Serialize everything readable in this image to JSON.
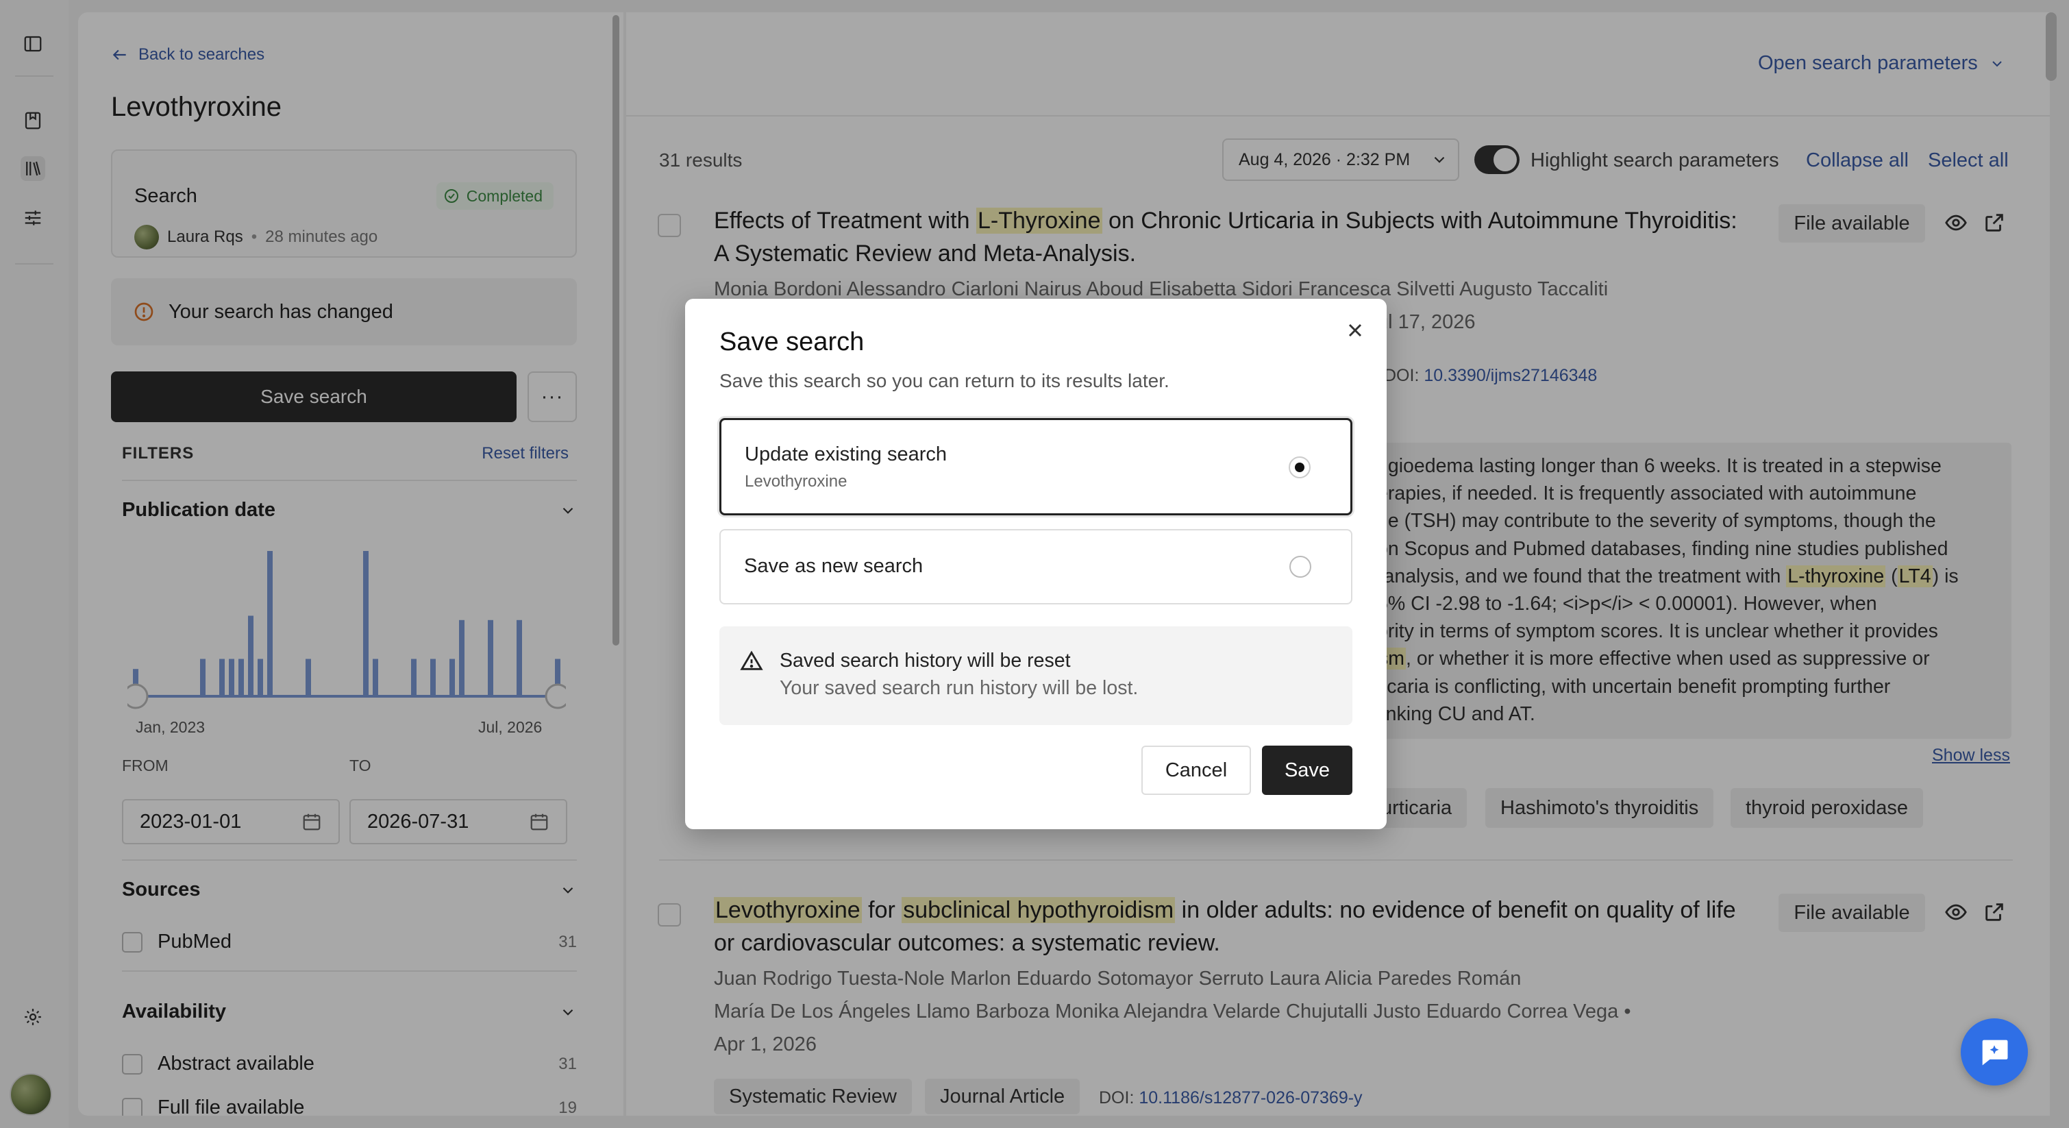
{
  "sidebar_left": {
    "panel_toggle_icon": "sidebar-toggle-icon",
    "nav_icons": [
      "bookmark-icon",
      "library-icon",
      "sliders-icon"
    ],
    "settings_icon": "gear-icon"
  },
  "search_panel": {
    "back_label": "Back to searches",
    "title": "Levothyroxine",
    "card": {
      "title": "Search",
      "status": "Completed",
      "user": "Laura Rqs",
      "time": "28 minutes ago"
    },
    "changed_notice": "Your search has changed",
    "save_label": "Save search",
    "more_label": "···",
    "filters_label": "FILTERS",
    "reset_label": "Reset filters",
    "publication_date": {
      "heading": "Publication date",
      "histogram_levels": [
        0.18,
        0,
        0,
        0,
        0,
        0,
        0,
        0.25,
        0,
        0.25,
        0.25,
        0.25,
        0.55,
        0.25,
        1.0,
        0,
        0,
        0,
        0.25,
        0,
        0,
        0,
        0,
        0,
        1.0,
        0.25,
        0,
        0,
        0,
        0.25,
        0,
        0.25,
        0,
        0.25,
        0.52,
        0,
        0,
        0.52,
        0,
        0,
        0.52,
        0,
        0,
        0,
        0.25
      ],
      "start_label": "Jan, 2023",
      "end_label": "Jul, 2026",
      "from_label": "FROM",
      "to_label": "TO",
      "from_value": "2023-01-01",
      "to_value": "2026-07-31"
    },
    "sources": {
      "heading": "Sources",
      "items": [
        {
          "label": "PubMed",
          "count": "31"
        }
      ]
    },
    "availability": {
      "heading": "Availability",
      "items": [
        {
          "label": "Abstract available",
          "count": "31"
        },
        {
          "label": "Full file available",
          "count": "19"
        }
      ]
    }
  },
  "results_area": {
    "open_params_label": "Open search parameters",
    "results_count": "31 results",
    "run_date": "Aug 4, 2026 · 2:32 PM",
    "highlight_label": "Highlight search parameters",
    "collapse_label": "Collapse all",
    "select_label": "Select all",
    "show_less": "Show less",
    "results": [
      {
        "title_parts": [
          {
            "t": "Effects of Treatment with ",
            "h": false
          },
          {
            "t": "L-Thyroxine",
            "h": true
          },
          {
            "t": " on Chronic Urticaria in Subjects with Autoimmune Thyroiditis: A Systematic Review and Meta-Analysis.",
            "h": false
          }
        ],
        "authors_line1": "Monia Bordoni  Alessandro Ciarloni  Nairus Aboud  Elisabetta Sidori  Francesca Silvetti  Augusto Taccaliti",
        "date_fragment": "ul 17, 2026",
        "doi_label": "DOI:",
        "doi": "10.3390/ijms27146348",
        "file_label": "File available",
        "abstract_lines": [
          "ngioedema lasting longer than 6 weeks. It is treated in a stepwise",
          "erapies, if needed. It is frequently associated with autoimmune",
          "ne (TSH) may contribute to the severity of symptoms, though the",
          "on Scopus and Pubmed databases, finding nine studies published",
          "-analysis, and we found that the treatment with |L-thyroxine| (|LT4|) is",
          "5% CI -2.98 to -1.64; <i>p</i> < 0.00001). However, when",
          "ority in terms of symptom scores. It is unclear whether it provides",
          "|sm|, or whether it is more effective when used as suppressive or",
          "ticaria is conflicting, with uncertain benefit prompting further",
          "linking CU and AT."
        ],
        "tags": [
          "urticaria",
          "Hashimoto's thyroiditis",
          "thyroid peroxidase"
        ]
      },
      {
        "title_parts": [
          {
            "t": "Levothyroxine",
            "h": true
          },
          {
            "t": " for ",
            "h": false
          },
          {
            "t": "subclinical hypothyroidism",
            "h": true
          },
          {
            "t": " in older adults: no evidence of benefit on quality of life or cardiovascular outcomes: a systematic review.",
            "h": false
          }
        ],
        "authors_line1": "Juan Rodrigo Tuesta-Nole  Marlon Eduardo Sotomayor Serruto  Laura Alicia Paredes Román",
        "authors_line2": "María De Los Ángeles Llamo Barboza  Monika Alejandra Velarde Chujutalli  Justo Eduardo Correa Vega  •",
        "date": "Apr 1, 2026",
        "file_label": "File available",
        "tags": [
          "Systematic Review",
          "Journal Article"
        ],
        "doi_label": "DOI:",
        "doi": "10.1186/s12877-026-07369-y"
      }
    ]
  },
  "modal": {
    "title": "Save search",
    "subtitle": "Save this search so you can return to its results later.",
    "option_update_title": "Update existing search",
    "option_update_sub": "Levothyroxine",
    "option_new_title": "Save as new search",
    "selected_option": "update",
    "warning_title": "Saved search history will be reset",
    "warning_text": "Your saved search run history will be lost.",
    "cancel_label": "Cancel",
    "save_label": "Save"
  },
  "chat_fab_icon": "chat-icon",
  "colors": {
    "accent_link": "#3a5ca8",
    "highlight": "#f7f1b8",
    "histogram_bar": "#7b9ad6",
    "completed_green": "#3d8a45",
    "fab_blue": "#2f6fe6"
  }
}
